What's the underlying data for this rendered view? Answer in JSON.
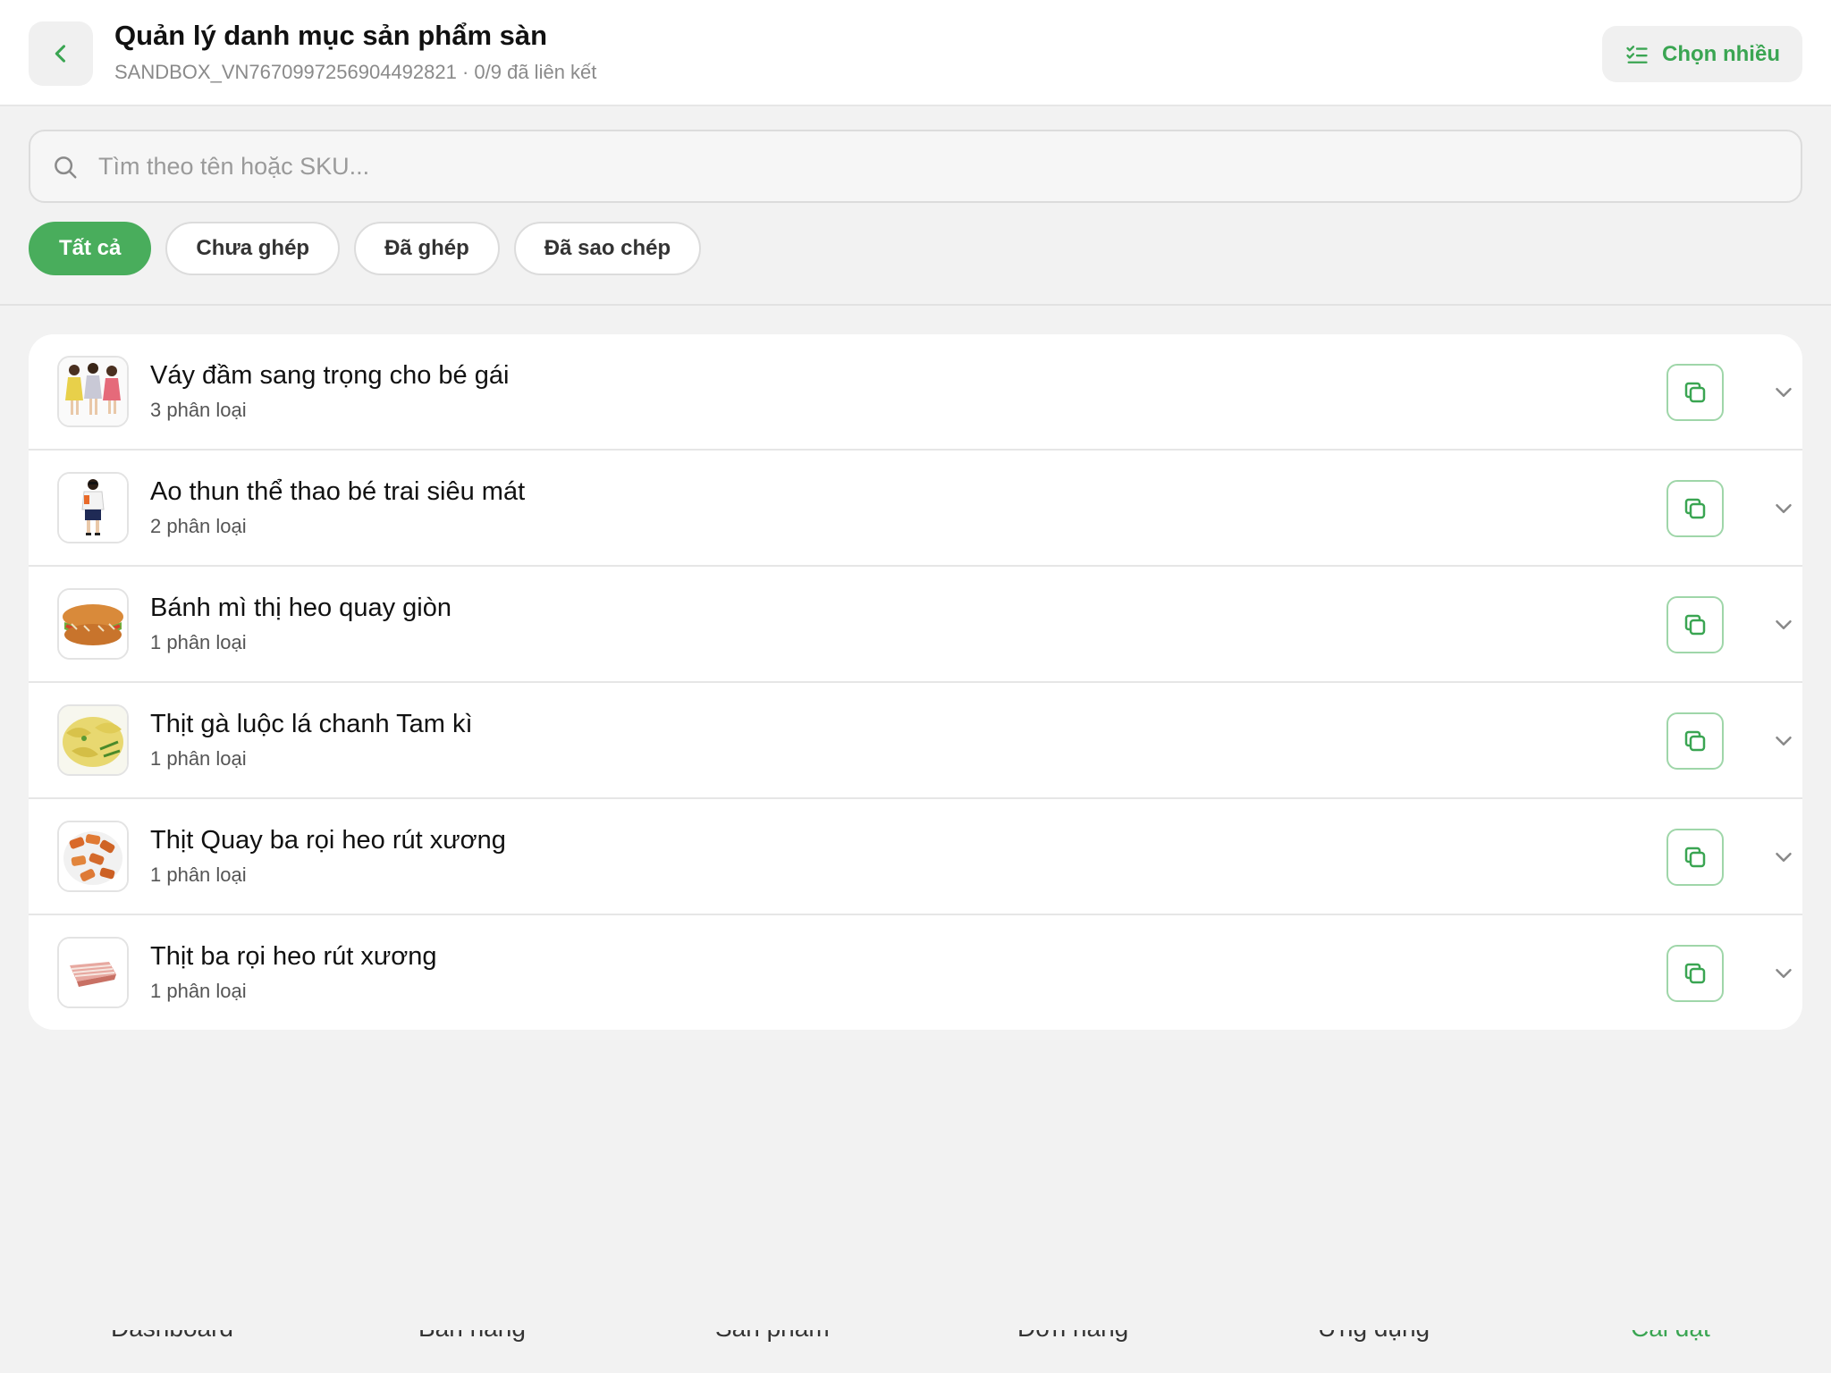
{
  "header": {
    "title": "Quản lý danh mục sản phẩm sàn",
    "subtitle": "SANDBOX_VN7670997256904492821 · 0/9 đã liên kết",
    "multi_select_label": "Chọn nhiều"
  },
  "search": {
    "placeholder": "Tìm theo tên hoặc SKU..."
  },
  "filters": [
    {
      "label": "Tất cả",
      "active": true
    },
    {
      "label": "Chưa ghép",
      "active": false
    },
    {
      "label": "Đã ghép",
      "active": false
    },
    {
      "label": "Đã sao chép",
      "active": false
    }
  ],
  "products": [
    {
      "name": "Váy đầm sang trọng cho bé gái",
      "variants": "3 phân loại",
      "thumb_icon": "girls-dresses-image"
    },
    {
      "name": "Ao thun thể thao bé trai siêu mát",
      "variants": "2 phân loại",
      "thumb_icon": "boy-tshirt-image"
    },
    {
      "name": "Bánh mì thị heo quay giòn",
      "variants": "1 phân loại",
      "thumb_icon": "banh-mi-image"
    },
    {
      "name": "Thịt gà luộc lá chanh Tam kì",
      "variants": "1 phân loại",
      "thumb_icon": "boiled-chicken-image"
    },
    {
      "name": "Thịt Quay ba rọi heo rút xương",
      "variants": "1 phân loại",
      "thumb_icon": "roast-pork-image"
    },
    {
      "name": "Thịt ba rọi heo rút xương",
      "variants": "1 phân loại",
      "thumb_icon": "pork-belly-image"
    }
  ],
  "bottom_nav": [
    {
      "label": "Dashboard",
      "active": false
    },
    {
      "label": "Bán hàng",
      "active": false
    },
    {
      "label": "Sản phẩm",
      "active": false
    },
    {
      "label": "Đơn hàng",
      "active": false
    },
    {
      "label": "Ứng dụng",
      "active": false
    },
    {
      "label": "Cài đặt",
      "active": true
    }
  ],
  "colors": {
    "accent": "#49ad5c",
    "accent_text": "#3aa552",
    "background": "#f2f2f2"
  }
}
